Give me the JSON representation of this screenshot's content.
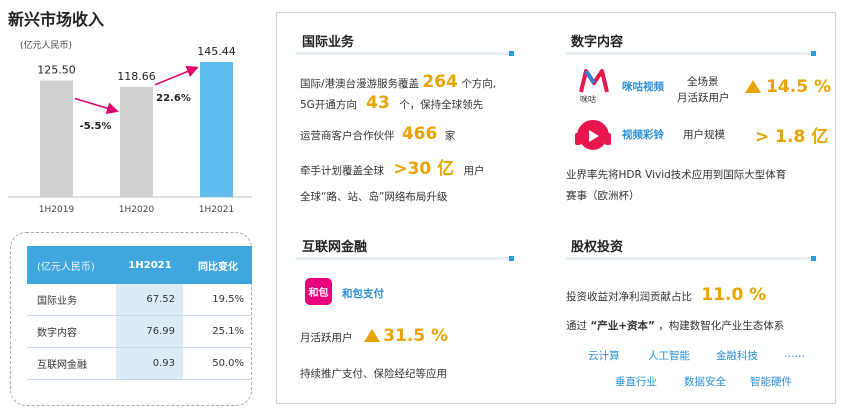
{
  "left": {
    "title": "新兴市场收入",
    "unit": "(亿元人民币)",
    "table": {
      "headers": [
        "(亿元人民币)",
        "1H2021",
        "同比变化"
      ],
      "rows": [
        [
          "国际业务",
          "67.52",
          "19.5%"
        ],
        [
          "数字内容",
          "76.99",
          "25.1%"
        ],
        [
          "互联网金融",
          "0.93",
          "50.0%"
        ]
      ]
    }
  },
  "chart_data": {
    "type": "bar",
    "categories": [
      "1H2019",
      "1H2020",
      "1H2021"
    ],
    "values": [
      125.5,
      118.66,
      145.44
    ],
    "value_labels": [
      "125.50",
      "118.66",
      "145.44"
    ],
    "growth_labels": [
      "-5.5%",
      "22.6%"
    ],
    "colors": [
      "#d0d0d0",
      "#d0d0d0",
      "#5fbef0"
    ],
    "arrow_color": "#e0006a",
    "title": "",
    "xlabel": "",
    "ylabel": ""
  },
  "intl": {
    "title": "国际业务",
    "l1a": "国际/港澳台漫游服务覆盖",
    "l1n": "264",
    "l1b": "个方向,",
    "l2a": "5G开通方向",
    "l2n": "43",
    "l2b": "个，保持全球领先",
    "l3a": "运营商客户合作伙伴",
    "l3n": "466",
    "l3b": "家",
    "l4a": "牵手计划覆盖全球",
    "l4n": ">30 亿",
    "l4b": "用户",
    "l5": "全球“路、站、岛”网络布局升级"
  },
  "digital": {
    "title": "数字内容",
    "migu_logo_text": "咪咕",
    "app1": "咪咕视频",
    "app1_desc1": "全场景",
    "app1_desc2": "月活跃用户",
    "app1_value": "14.5 %",
    "app2": "视频彩铃",
    "app2_desc": "用户规模",
    "app2_value": "> 1.8 亿",
    "l3": "业界率先将HDR Vivid技术应用到国际大型体育",
    "l4": "赛事（欧洲杯）"
  },
  "fintech": {
    "title": "互联网金融",
    "app": "和包支付",
    "logo_text": "和包",
    "mau_label": "月活跃用户",
    "mau_value": "31.5 %",
    "l3": "持续推广支付、保险经纪等应用"
  },
  "equity": {
    "title": "股权投资",
    "l1a": "投资收益对净利润贡献占比",
    "l1n": "11.0 %",
    "l2a": "通过",
    "l2q": "“产业+资本”",
    "l2b": "，构建数智化产业生态体系",
    "kw_row1": [
      "云计算",
      "人工智能",
      "金融科技",
      "……"
    ],
    "kw_row2": [
      "垂直行业",
      "数据安全",
      "智能硬件"
    ]
  },
  "colors": {
    "accent": "#e8a300",
    "blue": "#2a8fd6",
    "header": "#3fa6de"
  }
}
